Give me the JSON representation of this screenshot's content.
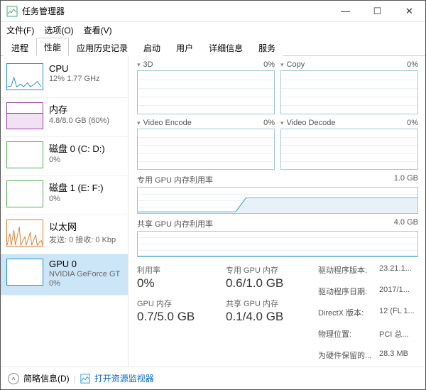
{
  "window": {
    "title": "任务管理器"
  },
  "menu": {
    "file": "文件(F)",
    "options": "选项(O)",
    "view": "查看(V)"
  },
  "tabs": {
    "processes": "进程",
    "performance": "性能",
    "app_history": "应用历史记录",
    "startup": "启动",
    "users": "用户",
    "details": "详细信息",
    "services": "服务"
  },
  "sidebar": {
    "cpu": {
      "title": "CPU",
      "sub": "12% 1.77 GHz",
      "color": "#1e90d2"
    },
    "memory": {
      "title": "内存",
      "sub": "4.8/8.0 GB (60%)",
      "color": "#9b3fa0"
    },
    "disk0": {
      "title": "磁盘 0 (C: D:)",
      "sub": "0%",
      "color": "#4caf50"
    },
    "disk1": {
      "title": "磁盘 1 (E: F:)",
      "sub": "0%",
      "color": "#4caf50"
    },
    "ethernet": {
      "title": "以太网",
      "sub": "发送: 0 接收: 0 Kbp",
      "color": "#e07b2e"
    },
    "gpu0": {
      "title": "GPU 0",
      "sub": "NVIDIA GeForce GT",
      "sub2": "0%",
      "color": "#1e90d2"
    }
  },
  "charts": {
    "c3d": {
      "label": "3D",
      "value": "0%"
    },
    "copy": {
      "label": "Copy",
      "value": "0%"
    },
    "venc": {
      "label": "Video Encode",
      "value": "0%"
    },
    "vdec": {
      "label": "Video Decode",
      "value": "0%"
    },
    "dedicated": {
      "label": "专用 GPU 内存利用率",
      "max": "1.0 GB"
    },
    "shared": {
      "label": "共享 GPU 内存利用率",
      "max": "4.0 GB"
    }
  },
  "stats": {
    "util_lbl": "利用率",
    "util_val": "0%",
    "gpu_mem_lbl": "GPU 内存",
    "gpu_mem_val": "0.7/5.0 GB",
    "ded_lbl": "专用 GPU 内存",
    "ded_val": "0.6/1.0 GB",
    "shr_lbl": "共享 GPU 内存",
    "shr_val": "0.1/4.0 GB"
  },
  "details": {
    "driver_ver_k": "驱动程序版本:",
    "driver_ver_v": "23.21.1...",
    "driver_date_k": "驱动程序日期:",
    "driver_date_v": "2017/1...",
    "directx_k": "DirectX 版本:",
    "directx_v": "12 (FL 1...",
    "phys_loc_k": "物理位置:",
    "phys_loc_v": "PCI 总...",
    "hw_reserve_k": "为硬件保留的...",
    "hw_reserve_v": "28.3 MB"
  },
  "footer": {
    "brief": "简略信息(D)",
    "resmon": "打开资源监视器"
  }
}
